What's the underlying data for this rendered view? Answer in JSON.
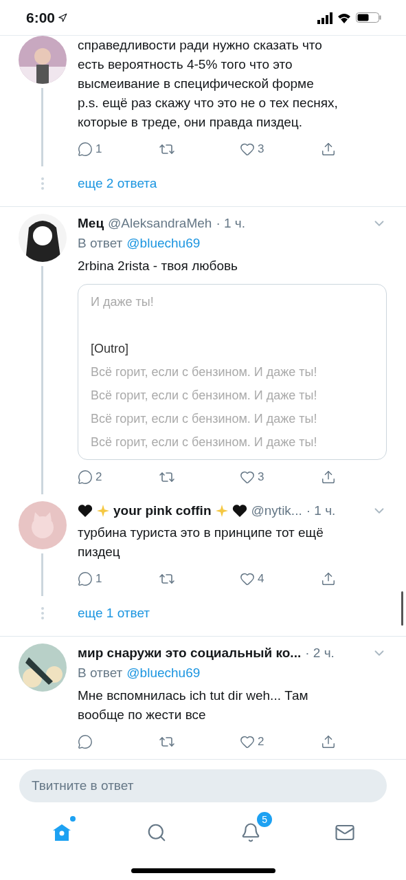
{
  "status_bar": {
    "time": "6:00"
  },
  "tweets": [
    {
      "thread_line": true,
      "body": "справедливости ради нужно сказать что\nесть вероятность 4-5% того что это\nвысмеивание в специфической форме\np.s. ещё раз скажу что это не о тех песнях,\nкоторые в треде, они правда пиздец.",
      "replies": "1",
      "likes": "3",
      "more": "еще 2 ответа"
    },
    {
      "thread_line": true,
      "name": "Мец",
      "handle": "@AleksandraMeh",
      "time": "· 1 ч.",
      "reply_label": "В ответ",
      "reply_to": "@bluechu69",
      "body": "2rbina 2rista - твоя любовь",
      "card": [
        {
          "kind": "lyric",
          "text": "И даже ты!"
        },
        {
          "kind": "gap"
        },
        {
          "kind": "heading",
          "text": "[Outro]"
        },
        {
          "kind": "lyric",
          "text": "Всё горит, если с бензином. И даже ты!"
        },
        {
          "kind": "lyric",
          "text": "Всё горит, если с бензином. И даже ты!"
        },
        {
          "kind": "lyric",
          "text": "Всё горит, если с бензином. И даже ты!"
        },
        {
          "kind": "lyric",
          "text": "Всё горит, если с бензином. И даже ты!"
        }
      ],
      "replies": "2",
      "likes": "3"
    },
    {
      "thread_line": true,
      "decorated": true,
      "name": "your pink coffin",
      "handle": "@nytik...",
      "time": "· 1 ч.",
      "body": "турбина туриста это в принципе тот ещё\nпиздец",
      "replies": "1",
      "likes": "4",
      "more": "еще 1 ответ"
    },
    {
      "thread_line": false,
      "name": "мир снаружи это социальный ко...",
      "time": "· 2 ч.",
      "reply_label": "В ответ",
      "reply_to": "@bluechu69",
      "body": "Мне вспомнилась ich tut dir weh... Там\nвообще по жести все",
      "likes": "2"
    }
  ],
  "compose": {
    "placeholder": "Твитните в ответ"
  },
  "tab_bar": [
    {
      "kind": "home",
      "selected": true,
      "dot": true
    },
    {
      "kind": "search",
      "selected": false
    },
    {
      "kind": "notifications",
      "selected": false,
      "badge": "5"
    },
    {
      "kind": "messages",
      "selected": false
    }
  ]
}
